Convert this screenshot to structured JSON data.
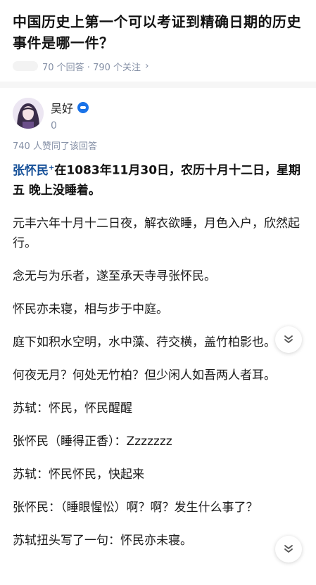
{
  "question": {
    "title": "中国历史上第一个可以考证到精确日期的历史事件是哪一件？",
    "meta": "70 个回答 · 790 个关注"
  },
  "answer": {
    "author_name": "吴好",
    "author_sub": "0",
    "voters": "740 人赞同了该回答",
    "mention": "张怀民",
    "lead_rest": "在1083年11月30日，农历十月十二日，星期五  晚上没睡着。",
    "paragraphs": [
      "元丰六年十月十二日夜，解衣欲睡，月色入户，欣然起行。",
      "念无与为乐者，遂至承天寺寻张怀民。",
      "怀民亦未寝，相与步于中庭。",
      "庭下如积水空明，水中藻、荇交横，盖竹柏影也。",
      "何夜无月？何处无竹柏？但少闲人如吾两人者耳。",
      "苏轼：怀民，怀民醒醒",
      "张怀民（睡得正香）：Zzzzzzz",
      "苏轼：怀民怀民，快起来",
      "张怀民：（睡眼惺忪）啊？啊？发生什么事了？",
      "苏轼扭头写了一句：怀民亦未寝。"
    ]
  },
  "colors": {
    "link": "#175199",
    "meta": "#8590a6",
    "badge": "#1a73e8"
  }
}
